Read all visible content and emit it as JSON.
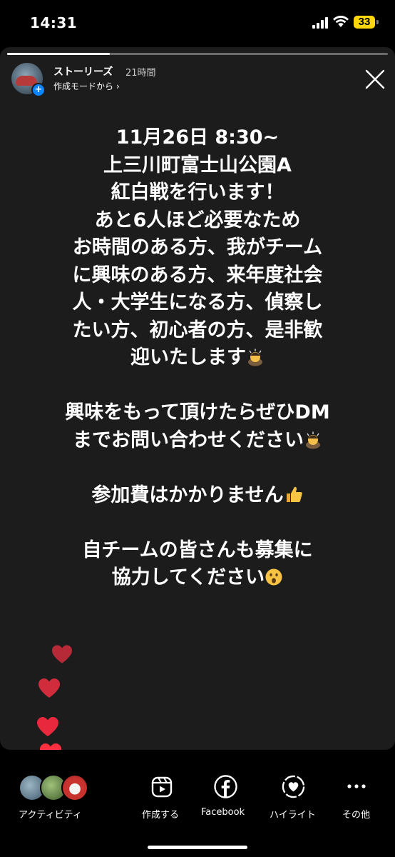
{
  "status_bar": {
    "time": "14:31",
    "battery": "33"
  },
  "story": {
    "progress": 0.27,
    "username": "ストーリーズ",
    "time_ago": "21時間",
    "subtitle": "作成モードから",
    "lines": [
      "11月26日 8:30~",
      "上三川町富士山公園A",
      "紅白戦を行います！",
      "あと6人ほど必要なため",
      "お時間のある方、我がチーム",
      "に興味のある方、来年度社会",
      "人・大学生になる方、偵察し",
      "たい方、初心者の方、是非歓",
      "迎いたします",
      "",
      "興味をもって頂けたらぜひDM",
      "までお問い合わせください",
      "",
      "参加費はかかりません",
      "",
      "自チームの皆さんも募集に",
      "協力してください"
    ],
    "heart_colors": [
      "#b52a36",
      "#d12c3c",
      "#e8283c",
      "#ff3040"
    ]
  },
  "bottom_bar": {
    "activity_label": "アクティビティ",
    "create_label": "作成する",
    "facebook_label": "Facebook",
    "highlight_label": "ハイライト",
    "more_label": "その他"
  }
}
